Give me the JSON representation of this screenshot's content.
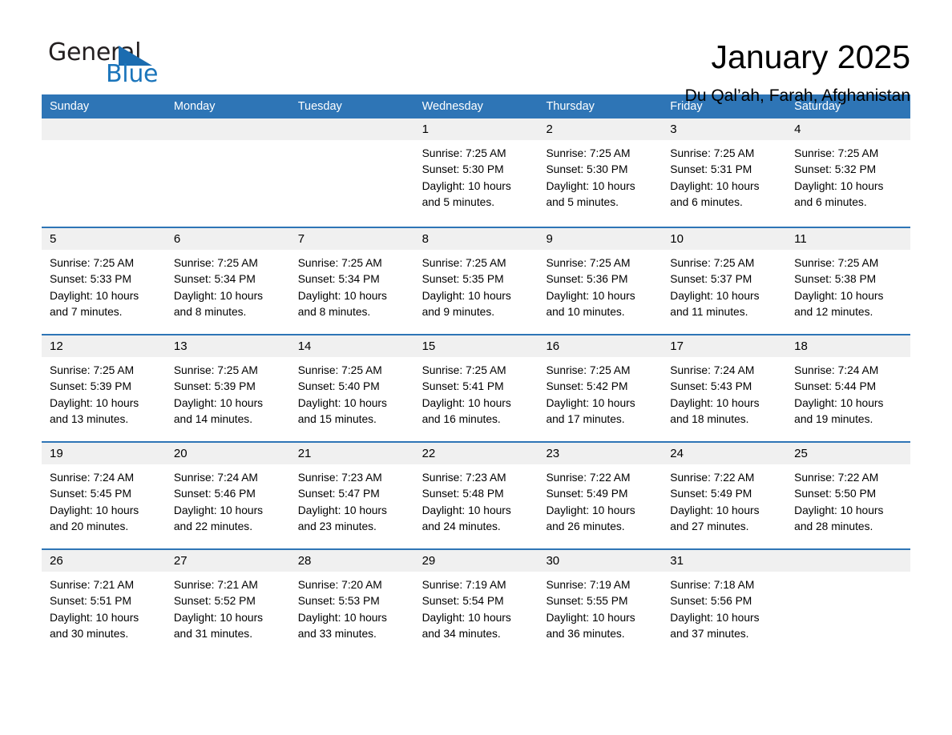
{
  "brand": {
    "name_part1": "General",
    "name_part2": "Blue",
    "triangle_color": "#1b6cb0",
    "blue_color": "#1b75bb"
  },
  "header": {
    "title": "January 2025",
    "subtitle": "Du Qal’ah, Farah, Afghanistan"
  },
  "theme": {
    "header_bg": "#2e75b6",
    "header_text": "#ffffff",
    "day_band_bg": "#f0f0f0",
    "cell_bg": "#ffffff",
    "row_divider": "#2e75b6"
  },
  "weekdays": [
    "Sunday",
    "Monday",
    "Tuesday",
    "Wednesday",
    "Thursday",
    "Friday",
    "Saturday"
  ],
  "weeks": [
    [
      {
        "day": "",
        "lines": [
          "",
          "",
          "",
          ""
        ]
      },
      {
        "day": "",
        "lines": [
          "",
          "",
          "",
          ""
        ]
      },
      {
        "day": "",
        "lines": [
          "",
          "",
          "",
          ""
        ]
      },
      {
        "day": "1",
        "lines": [
          "Sunrise: 7:25 AM",
          "Sunset: 5:30 PM",
          "Daylight: 10 hours",
          "and 5 minutes."
        ]
      },
      {
        "day": "2",
        "lines": [
          "Sunrise: 7:25 AM",
          "Sunset: 5:30 PM",
          "Daylight: 10 hours",
          "and 5 minutes."
        ]
      },
      {
        "day": "3",
        "lines": [
          "Sunrise: 7:25 AM",
          "Sunset: 5:31 PM",
          "Daylight: 10 hours",
          "and 6 minutes."
        ]
      },
      {
        "day": "4",
        "lines": [
          "Sunrise: 7:25 AM",
          "Sunset: 5:32 PM",
          "Daylight: 10 hours",
          "and 6 minutes."
        ]
      }
    ],
    [
      {
        "day": "5",
        "lines": [
          "Sunrise: 7:25 AM",
          "Sunset: 5:33 PM",
          "Daylight: 10 hours",
          "and 7 minutes."
        ]
      },
      {
        "day": "6",
        "lines": [
          "Sunrise: 7:25 AM",
          "Sunset: 5:34 PM",
          "Daylight: 10 hours",
          "and 8 minutes."
        ]
      },
      {
        "day": "7",
        "lines": [
          "Sunrise: 7:25 AM",
          "Sunset: 5:34 PM",
          "Daylight: 10 hours",
          "and 8 minutes."
        ]
      },
      {
        "day": "8",
        "lines": [
          "Sunrise: 7:25 AM",
          "Sunset: 5:35 PM",
          "Daylight: 10 hours",
          "and 9 minutes."
        ]
      },
      {
        "day": "9",
        "lines": [
          "Sunrise: 7:25 AM",
          "Sunset: 5:36 PM",
          "Daylight: 10 hours",
          "and 10 minutes."
        ]
      },
      {
        "day": "10",
        "lines": [
          "Sunrise: 7:25 AM",
          "Sunset: 5:37 PM",
          "Daylight: 10 hours",
          "and 11 minutes."
        ]
      },
      {
        "day": "11",
        "lines": [
          "Sunrise: 7:25 AM",
          "Sunset: 5:38 PM",
          "Daylight: 10 hours",
          "and 12 minutes."
        ]
      }
    ],
    [
      {
        "day": "12",
        "lines": [
          "Sunrise: 7:25 AM",
          "Sunset: 5:39 PM",
          "Daylight: 10 hours",
          "and 13 minutes."
        ]
      },
      {
        "day": "13",
        "lines": [
          "Sunrise: 7:25 AM",
          "Sunset: 5:39 PM",
          "Daylight: 10 hours",
          "and 14 minutes."
        ]
      },
      {
        "day": "14",
        "lines": [
          "Sunrise: 7:25 AM",
          "Sunset: 5:40 PM",
          "Daylight: 10 hours",
          "and 15 minutes."
        ]
      },
      {
        "day": "15",
        "lines": [
          "Sunrise: 7:25 AM",
          "Sunset: 5:41 PM",
          "Daylight: 10 hours",
          "and 16 minutes."
        ]
      },
      {
        "day": "16",
        "lines": [
          "Sunrise: 7:25 AM",
          "Sunset: 5:42 PM",
          "Daylight: 10 hours",
          "and 17 minutes."
        ]
      },
      {
        "day": "17",
        "lines": [
          "Sunrise: 7:24 AM",
          "Sunset: 5:43 PM",
          "Daylight: 10 hours",
          "and 18 minutes."
        ]
      },
      {
        "day": "18",
        "lines": [
          "Sunrise: 7:24 AM",
          "Sunset: 5:44 PM",
          "Daylight: 10 hours",
          "and 19 minutes."
        ]
      }
    ],
    [
      {
        "day": "19",
        "lines": [
          "Sunrise: 7:24 AM",
          "Sunset: 5:45 PM",
          "Daylight: 10 hours",
          "and 20 minutes."
        ]
      },
      {
        "day": "20",
        "lines": [
          "Sunrise: 7:24 AM",
          "Sunset: 5:46 PM",
          "Daylight: 10 hours",
          "and 22 minutes."
        ]
      },
      {
        "day": "21",
        "lines": [
          "Sunrise: 7:23 AM",
          "Sunset: 5:47 PM",
          "Daylight: 10 hours",
          "and 23 minutes."
        ]
      },
      {
        "day": "22",
        "lines": [
          "Sunrise: 7:23 AM",
          "Sunset: 5:48 PM",
          "Daylight: 10 hours",
          "and 24 minutes."
        ]
      },
      {
        "day": "23",
        "lines": [
          "Sunrise: 7:22 AM",
          "Sunset: 5:49 PM",
          "Daylight: 10 hours",
          "and 26 minutes."
        ]
      },
      {
        "day": "24",
        "lines": [
          "Sunrise: 7:22 AM",
          "Sunset: 5:49 PM",
          "Daylight: 10 hours",
          "and 27 minutes."
        ]
      },
      {
        "day": "25",
        "lines": [
          "Sunrise: 7:22 AM",
          "Sunset: 5:50 PM",
          "Daylight: 10 hours",
          "and 28 minutes."
        ]
      }
    ],
    [
      {
        "day": "26",
        "lines": [
          "Sunrise: 7:21 AM",
          "Sunset: 5:51 PM",
          "Daylight: 10 hours",
          "and 30 minutes."
        ]
      },
      {
        "day": "27",
        "lines": [
          "Sunrise: 7:21 AM",
          "Sunset: 5:52 PM",
          "Daylight: 10 hours",
          "and 31 minutes."
        ]
      },
      {
        "day": "28",
        "lines": [
          "Sunrise: 7:20 AM",
          "Sunset: 5:53 PM",
          "Daylight: 10 hours",
          "and 33 minutes."
        ]
      },
      {
        "day": "29",
        "lines": [
          "Sunrise: 7:19 AM",
          "Sunset: 5:54 PM",
          "Daylight: 10 hours",
          "and 34 minutes."
        ]
      },
      {
        "day": "30",
        "lines": [
          "Sunrise: 7:19 AM",
          "Sunset: 5:55 PM",
          "Daylight: 10 hours",
          "and 36 minutes."
        ]
      },
      {
        "day": "31",
        "lines": [
          "Sunrise: 7:18 AM",
          "Sunset: 5:56 PM",
          "Daylight: 10 hours",
          "and 37 minutes."
        ]
      },
      {
        "day": "",
        "lines": [
          "",
          "",
          "",
          ""
        ]
      }
    ]
  ]
}
